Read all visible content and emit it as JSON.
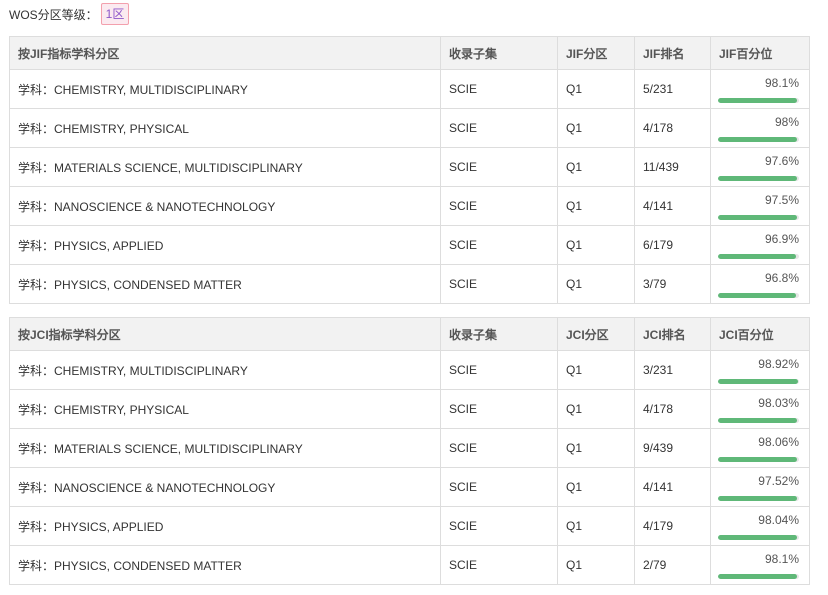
{
  "grade": {
    "label": "WOS分区等级：",
    "value": "1区"
  },
  "jif_table": {
    "headers": [
      "按JIF指标学科分区",
      "收录子集",
      "JIF分区",
      "JIF排名",
      "JIF百分位"
    ],
    "rows": [
      {
        "subject": "学科：CHEMISTRY, MULTIDISCIPLINARY",
        "collection": "SCIE",
        "quartile": "Q1",
        "rank": "5/231",
        "percentile_label": "98.1%",
        "percentile_value": 98.1
      },
      {
        "subject": "学科：CHEMISTRY, PHYSICAL",
        "collection": "SCIE",
        "quartile": "Q1",
        "rank": "4/178",
        "percentile_label": "98%",
        "percentile_value": 98
      },
      {
        "subject": "学科：MATERIALS SCIENCE, MULTIDISCIPLINARY",
        "collection": "SCIE",
        "quartile": "Q1",
        "rank": "11/439",
        "percentile_label": "97.6%",
        "percentile_value": 97.6
      },
      {
        "subject": "学科：NANOSCIENCE & NANOTECHNOLOGY",
        "collection": "SCIE",
        "quartile": "Q1",
        "rank": "4/141",
        "percentile_label": "97.5%",
        "percentile_value": 97.5
      },
      {
        "subject": "学科：PHYSICS, APPLIED",
        "collection": "SCIE",
        "quartile": "Q1",
        "rank": "6/179",
        "percentile_label": "96.9%",
        "percentile_value": 96.9
      },
      {
        "subject": "学科：PHYSICS, CONDENSED MATTER",
        "collection": "SCIE",
        "quartile": "Q1",
        "rank": "3/79",
        "percentile_label": "96.8%",
        "percentile_value": 96.8
      }
    ]
  },
  "jci_table": {
    "headers": [
      "按JCI指标学科分区",
      "收录子集",
      "JCI分区",
      "JCI排名",
      "JCI百分位"
    ],
    "rows": [
      {
        "subject": "学科：CHEMISTRY, MULTIDISCIPLINARY",
        "collection": "SCIE",
        "quartile": "Q1",
        "rank": "3/231",
        "percentile_label": "98.92%",
        "percentile_value": 98.92
      },
      {
        "subject": "学科：CHEMISTRY, PHYSICAL",
        "collection": "SCIE",
        "quartile": "Q1",
        "rank": "4/178",
        "percentile_label": "98.03%",
        "percentile_value": 98.03
      },
      {
        "subject": "学科：MATERIALS SCIENCE, MULTIDISCIPLINARY",
        "collection": "SCIE",
        "quartile": "Q1",
        "rank": "9/439",
        "percentile_label": "98.06%",
        "percentile_value": 98.06
      },
      {
        "subject": "学科：NANOSCIENCE & NANOTECHNOLOGY",
        "collection": "SCIE",
        "quartile": "Q1",
        "rank": "4/141",
        "percentile_label": "97.52%",
        "percentile_value": 97.52
      },
      {
        "subject": "学科：PHYSICS, APPLIED",
        "collection": "SCIE",
        "quartile": "Q1",
        "rank": "4/179",
        "percentile_label": "98.04%",
        "percentile_value": 98.04
      },
      {
        "subject": "学科：PHYSICS, CONDENSED MATTER",
        "collection": "SCIE",
        "quartile": "Q1",
        "rank": "2/79",
        "percentile_label": "98.1%",
        "percentile_value": 98.1
      }
    ]
  },
  "colors": {
    "bar_fill": "#5fb878",
    "bar_track": "#e6e6e6",
    "badge_border": "#f3a0ad",
    "badge_text": "#8d56c9"
  }
}
